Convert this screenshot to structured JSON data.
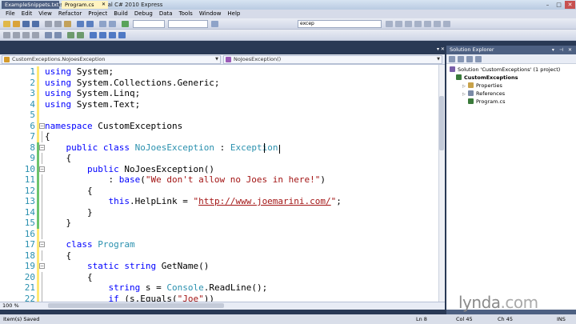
{
  "window": {
    "title": "CustomExceptions - Microsoft Visual C# 2010 Express"
  },
  "menu": [
    "File",
    "Edit",
    "View",
    "Refactor",
    "Project",
    "Build",
    "Debug",
    "Data",
    "Tools",
    "Window",
    "Help"
  ],
  "toolbar": {
    "find_value": "excep"
  },
  "tabs": [
    {
      "label": "ExampleSnippets.txt",
      "active": false
    },
    {
      "label": "Program.cs",
      "active": true
    }
  ],
  "navbar": {
    "class_combo": "CustomExceptions.NoJoesException",
    "member_combo": "NoJoesException()"
  },
  "editor": {
    "zoom": "100 %",
    "lines": [
      {
        "n": "1",
        "html": "<span class='kw'>using</span> System;"
      },
      {
        "n": "2",
        "html": "<span class='kw'>using</span> System.Collections.Generic;"
      },
      {
        "n": "3",
        "html": "<span class='kw'>using</span> System.Linq;"
      },
      {
        "n": "4",
        "html": "<span class='kw'>using</span> System.Text;"
      },
      {
        "n": "5",
        "html": ""
      },
      {
        "n": "6",
        "html": "<span class='kw'>namespace</span> CustomExceptions"
      },
      {
        "n": "7",
        "html": "{"
      },
      {
        "n": "8",
        "html": "    <span class='kw'>public</span> <span class='kw'>class</span> <span class='ty'>NoJoesException</span> : <span class='ty'>Exception</span>"
      },
      {
        "n": "9",
        "html": "    {"
      },
      {
        "n": "10",
        "html": "        <span class='kw'>public</span> NoJoesException()"
      },
      {
        "n": "11",
        "html": "            : <span class='kw'>base</span>(<span class='st'>\"We don't allow no Joes in here!\"</span>)"
      },
      {
        "n": "12",
        "html": "        {"
      },
      {
        "n": "13",
        "html": "            <span class='kw'>this</span>.HelpLink = <span class='st'>\"</span><span class='url'>http://www.joemarini.com/</span><span class='st'>\"</span>;"
      },
      {
        "n": "14",
        "html": "        }"
      },
      {
        "n": "15",
        "html": "    }"
      },
      {
        "n": "16",
        "html": ""
      },
      {
        "n": "17",
        "html": "    <span class='kw'>class</span> <span class='ty'>Program</span>"
      },
      {
        "n": "18",
        "html": "    {"
      },
      {
        "n": "19",
        "html": "        <span class='kw'>static</span> <span class='kw'>string</span> GetName()"
      },
      {
        "n": "20",
        "html": "        {"
      },
      {
        "n": "21",
        "html": "            <span class='kw'>string</span> s = <span class='ty'>Console</span>.ReadLine();"
      },
      {
        "n": "22",
        "html": "            <span class='kw'>if</span> (s.Equals(<span class='st'>\"Joe\"</span>))"
      }
    ]
  },
  "solution_explorer": {
    "title": "Solution Explorer",
    "items": [
      {
        "label": "Solution 'CustomExceptions' (1 project)",
        "indent": 0,
        "bold": false,
        "icon": "solution-icon",
        "color": "#7a5fa8"
      },
      {
        "label": "CustomExceptions",
        "indent": 1,
        "bold": true,
        "icon": "csharp-project-icon",
        "color": "#3a7a3a"
      },
      {
        "label": "Properties",
        "indent": 2,
        "bold": false,
        "icon": "properties-icon",
        "color": "#c8a24a"
      },
      {
        "label": "References",
        "indent": 2,
        "bold": false,
        "icon": "references-icon",
        "color": "#7a8aa6"
      },
      {
        "label": "Program.cs",
        "indent": 2,
        "bold": false,
        "icon": "csharp-file-icon",
        "color": "#3a7a3a"
      }
    ]
  },
  "status": {
    "message": "Item(s) Saved",
    "ln": "Ln 8",
    "col": "Col 45",
    "ch": "Ch 45",
    "mode": "INS"
  },
  "watermark": {
    "brand": "lynda",
    "suffix": ".com"
  }
}
